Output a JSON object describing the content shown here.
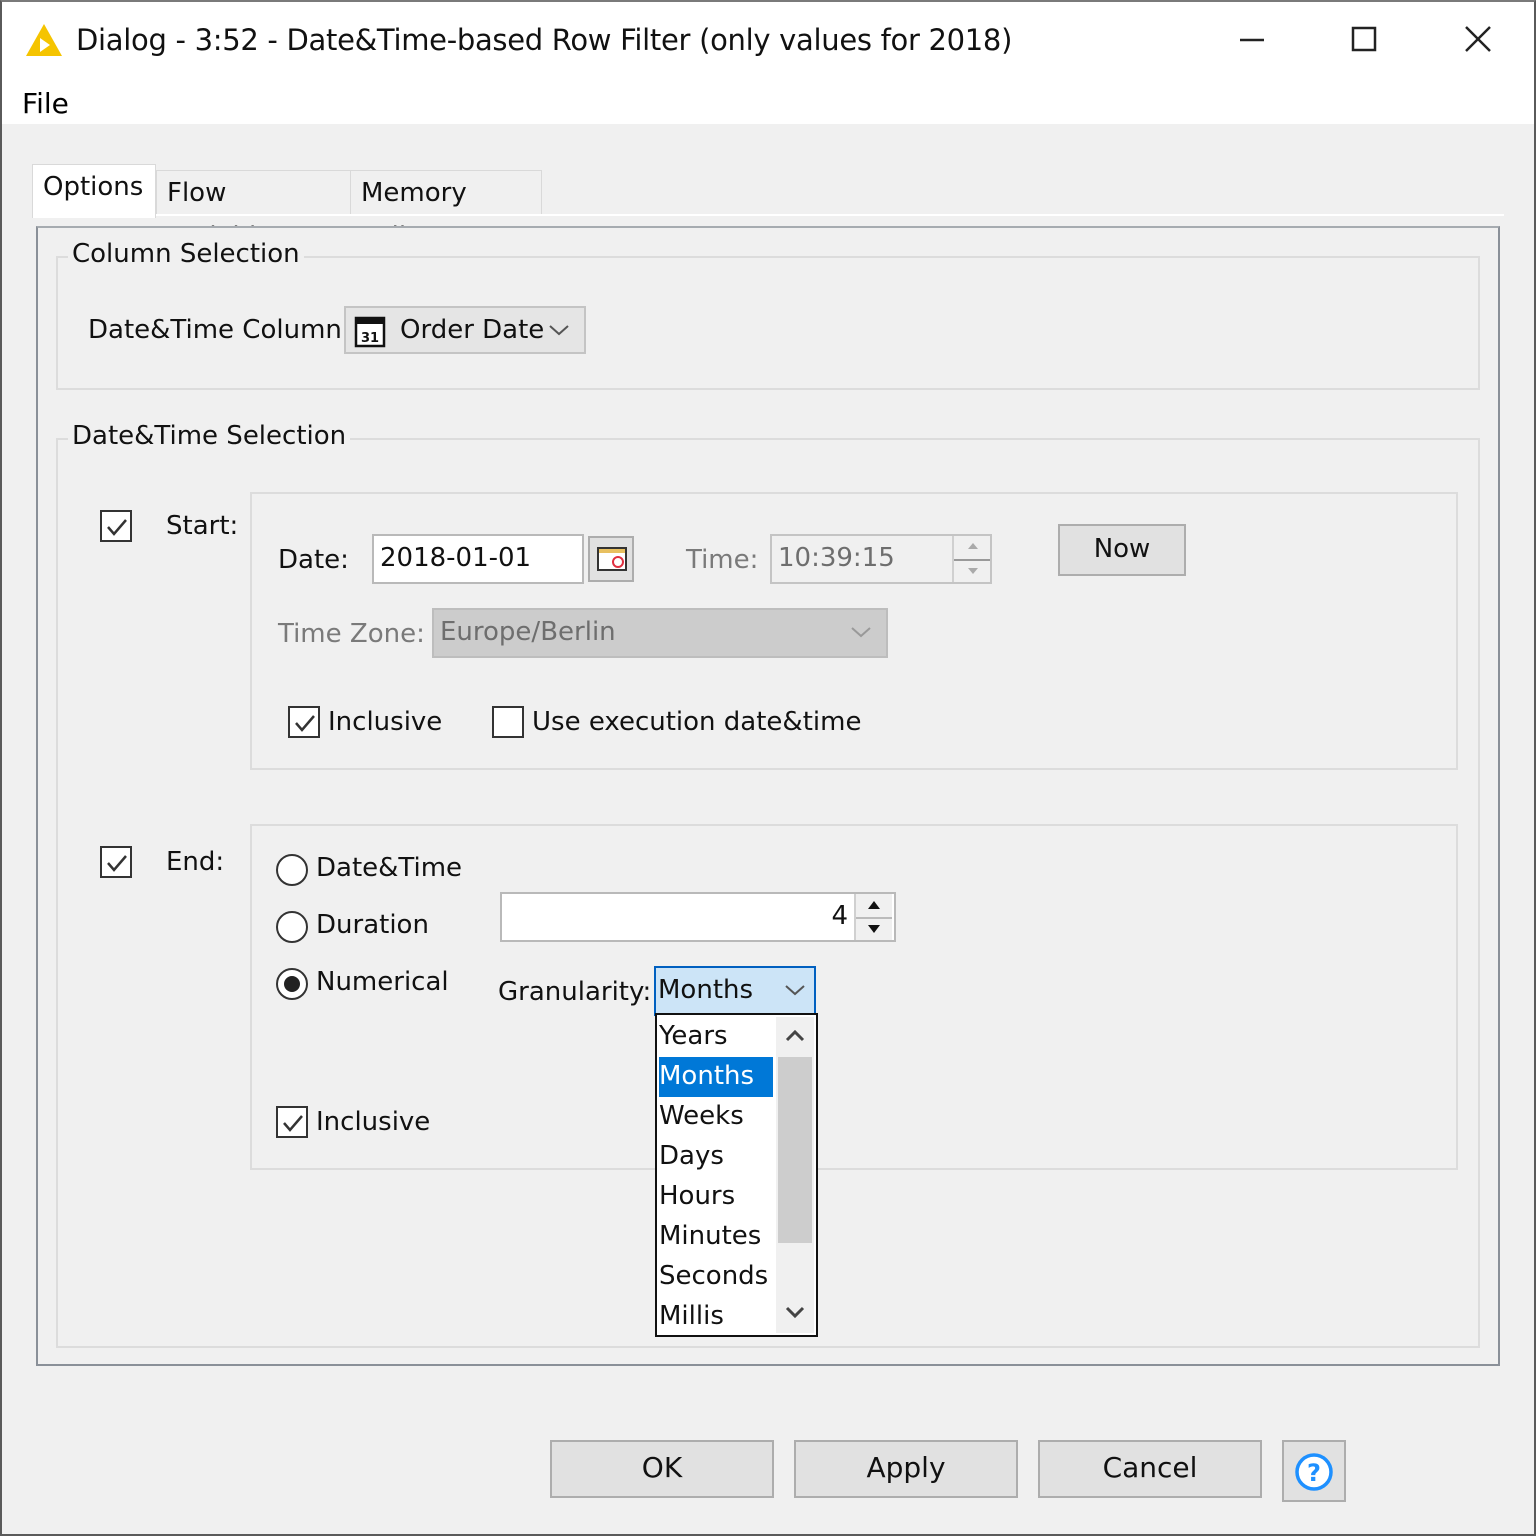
{
  "window": {
    "title": "Dialog - 3:52 - Date&Time-based Row Filter (only values for 2018)",
    "app_icon": "knime-triangle-icon",
    "controls": [
      "minimize-icon",
      "maximize-icon",
      "close-icon"
    ]
  },
  "menu": {
    "file": "File"
  },
  "tabs": [
    {
      "label": "Options",
      "active": true
    },
    {
      "label": "Flow Variables",
      "active": false
    },
    {
      "label": "Memory Policy",
      "active": false
    }
  ],
  "column_selection": {
    "title": "Column Selection",
    "label": "Date&Time Column:",
    "value": "Order Date",
    "icon": "calendar-31-icon"
  },
  "datetime_selection": {
    "title": "Date&Time Selection",
    "start": {
      "label": "Start:",
      "checked": true,
      "date_label": "Date:",
      "date_value": "2018-01-01",
      "time_label": "Time:",
      "time_value": "10:39:15",
      "now_button": "Now",
      "timezone_label": "Time Zone:",
      "timezone_value": "Europe/Berlin",
      "inclusive_label": "Inclusive",
      "inclusive_checked": true,
      "use_execution_label": "Use execution date&time",
      "use_execution_checked": false
    },
    "end": {
      "label": "End:",
      "checked": true,
      "radio_options": [
        "Date&Time",
        "Duration",
        "Numerical"
      ],
      "selected_radio": "Numerical",
      "numeric_value": "4",
      "granularity_label": "Granularity:",
      "granularity_value": "Months",
      "granularity_options": [
        "Years",
        "Months",
        "Weeks",
        "Days",
        "Hours",
        "Minutes",
        "Seconds",
        "Millis"
      ],
      "inclusive_label": "Inclusive",
      "inclusive_checked": true
    }
  },
  "buttons": {
    "ok": "OK",
    "apply": "Apply",
    "cancel": "Cancel",
    "help_icon": "help-question-icon"
  },
  "colors": {
    "accent": "#0078d7",
    "focus_bg": "#cce4f7",
    "app_icon": "#f5c400",
    "help_icon": "#1e90ff"
  }
}
